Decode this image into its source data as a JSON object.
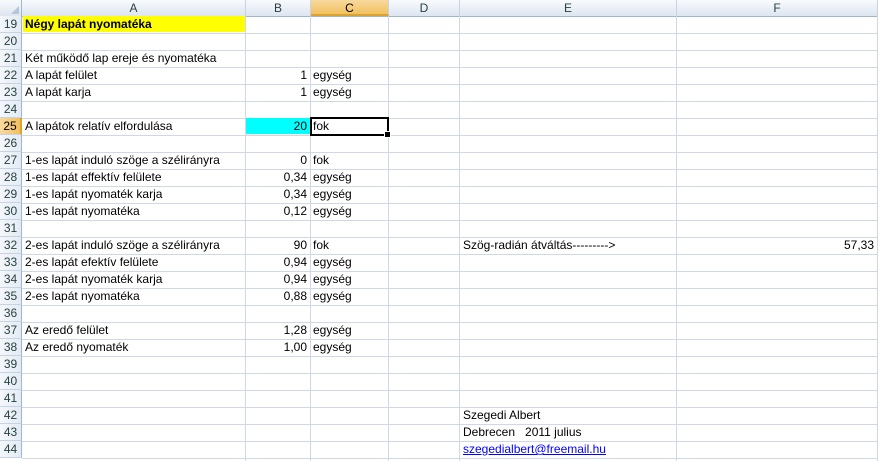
{
  "columns": [
    "A",
    "B",
    "C",
    "D",
    "E",
    "F"
  ],
  "rows": [
    "19",
    "20",
    "21",
    "22",
    "23",
    "24",
    "25",
    "26",
    "27",
    "28",
    "29",
    "30",
    "31",
    "32",
    "33",
    "34",
    "35",
    "36",
    "37",
    "38",
    "39",
    "40",
    "41",
    "42",
    "43",
    "44"
  ],
  "title": "Négy lapát nyomatéka",
  "section_heading": "Két működő lap ereje és nyomatéka",
  "params": {
    "surface_label": "A lapát felület",
    "surface_value": "1",
    "surface_unit": "egység",
    "arm_label": "A lapát karja",
    "arm_value": "1",
    "arm_unit": "egység",
    "rotation_label": "A lapátok relatív elfordulása",
    "rotation_value": "20",
    "rotation_unit": "fok"
  },
  "blade1": {
    "angle_label": "1-es lapát induló szöge a szélirányra",
    "angle_value": "0",
    "angle_unit": "fok",
    "surface_label": "1-es lapát effektív felülete",
    "surface_value": "0,34",
    "surface_unit": "egység",
    "arm_label": "1-es lapát nyomaték karja",
    "arm_value": "0,34",
    "arm_unit": "egység",
    "torque_label": "1-es lapát nyomatéka",
    "torque_value": "0,12",
    "torque_unit": "egység"
  },
  "blade2": {
    "angle_label": "2-es lapát induló szöge a szélirányra",
    "angle_value": "90",
    "angle_unit": "fok",
    "surface_label": "2-es lapát efektív felülete",
    "surface_value": "0,94",
    "surface_unit": "egység",
    "arm_label": "2-es lapát nyomaték karja",
    "arm_value": "0,94",
    "arm_unit": "egység",
    "torque_label": "2-es lapát nyomatéka",
    "torque_value": "0,88",
    "torque_unit": "egység"
  },
  "conversion": {
    "label": "Szög-radián átváltás--------->",
    "value": "57,33"
  },
  "result": {
    "surface_label": "Az eredő felület",
    "surface_value": "1,28",
    "surface_unit": "egység",
    "torque_label": "Az eredő nyomaték",
    "torque_value": "1,00",
    "torque_unit": "egység"
  },
  "author": {
    "name": "Szegedi Albert",
    "place_date": "Debrecen   2011 julius",
    "email": "szegedialbert@freemail.hu"
  },
  "colors": {
    "title_fill": "#ffff00",
    "input_fill": "#00ffff",
    "active_header": "#f1c15f"
  }
}
